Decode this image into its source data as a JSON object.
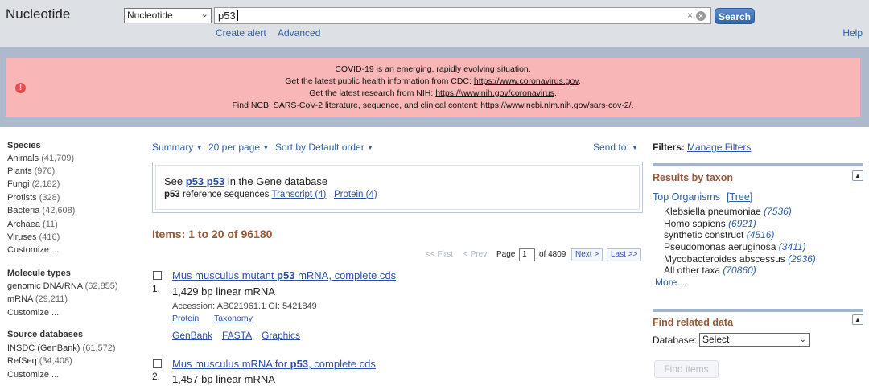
{
  "header": {
    "app_title": "Nucleotide",
    "db_select_value": "Nucleotide",
    "search_value": "p53",
    "clear_symbol": "×",
    "search_button": "Search",
    "create_alert": "Create alert",
    "advanced": "Advanced",
    "help": "Help"
  },
  "alert": {
    "line1": "COVID-19 is an emerging, rapidly evolving situation.",
    "line2_text": "Get the latest public health information from CDC:",
    "line2_link": "https://www.coronavirus.gov",
    "line2_end": ".",
    "line3_text": "Get the latest research from NIH:",
    "line3_link": "https://www.nih.gov/coronavirus",
    "line3_end": ".",
    "line4_text": "Find NCBI SARS-CoV-2 literature, sequence, and clinical content:",
    "line4_link": "https://www.ncbi.nlm.nih.gov/sars-cov-2/",
    "line4_end": "."
  },
  "facets": {
    "species_title": "Species",
    "species": [
      {
        "label": "Animals",
        "count": "(41,709)"
      },
      {
        "label": "Plants",
        "count": "(976)"
      },
      {
        "label": "Fungi",
        "count": "(2,182)"
      },
      {
        "label": "Protists",
        "count": "(328)"
      },
      {
        "label": "Bacteria",
        "count": "(42,608)"
      },
      {
        "label": "Archaea",
        "count": "(11)"
      },
      {
        "label": "Viruses",
        "count": "(416)"
      },
      {
        "label": "Customize ...",
        "count": ""
      }
    ],
    "molecule_title": "Molecule types",
    "molecule": [
      {
        "label": "genomic DNA/RNA",
        "count": "(62,855)"
      },
      {
        "label": "mRNA",
        "count": "(29,211)"
      },
      {
        "label": "Customize ...",
        "count": ""
      }
    ],
    "source_title": "Source databases",
    "source": [
      {
        "label": "INSDC (GenBank)",
        "count": "(61,572)"
      },
      {
        "label": "RefSeq",
        "count": "(34,408)"
      },
      {
        "label": "Customize ...",
        "count": ""
      }
    ]
  },
  "toolbar": {
    "summary": "Summary",
    "per_page": "20 per page",
    "sort": "Sort by Default order",
    "send_to": "Send to:"
  },
  "gene_box": {
    "see": "See",
    "link": "p53 p53",
    "rest": "in the Gene database",
    "line2_bold": "p53",
    "line2_text": "reference sequences",
    "transcript": "Transcript (4)",
    "protein": "Protein (4)"
  },
  "items_count": "Items: 1 to 20 of 96180",
  "pager": {
    "first": "<< First",
    "prev": "< Prev",
    "page_label": "Page",
    "page_value": "1",
    "of": "of 4809",
    "next": "Next >",
    "last": "Last >>"
  },
  "results": [
    {
      "num": "1.",
      "title_pre": "Mus musculus mutant ",
      "title_bold": "p53",
      "title_post": " mRNA, complete cds",
      "desc": "1,429 bp linear mRNA",
      "accession": "Accession: AB021961.1   GI: 5421849",
      "sub1": "Protein",
      "sub2": "Taxonomy",
      "link1": "GenBank",
      "link2": "FASTA",
      "link3": "Graphics"
    },
    {
      "num": "2.",
      "title_pre": "Mus musculus mRNA for ",
      "title_bold": "p53",
      "title_post": ", complete cds",
      "desc": "1,457 bp linear mRNA"
    }
  ],
  "sidebar": {
    "filters_label": "Filters:",
    "manage_filters": "Manage Filters",
    "taxon_title": "Results by taxon",
    "top_organisms": "Top Organisms",
    "tree": "[Tree]",
    "taxa": [
      {
        "name": "Klebsiella pneumoniae",
        "count": "(7536)"
      },
      {
        "name": "Homo sapiens",
        "count": "(6921)"
      },
      {
        "name": "synthetic construct",
        "count": "(4516)"
      },
      {
        "name": "Pseudomonas aeruginosa",
        "count": "(3411)"
      },
      {
        "name": "Mycobacteroides abscessus",
        "count": "(2936)"
      },
      {
        "name": "All other taxa",
        "count": "(70860)"
      }
    ],
    "more": "More...",
    "related_title": "Find related data",
    "database_label": "Database:",
    "database_value": "Select",
    "find_items": "Find items"
  }
}
